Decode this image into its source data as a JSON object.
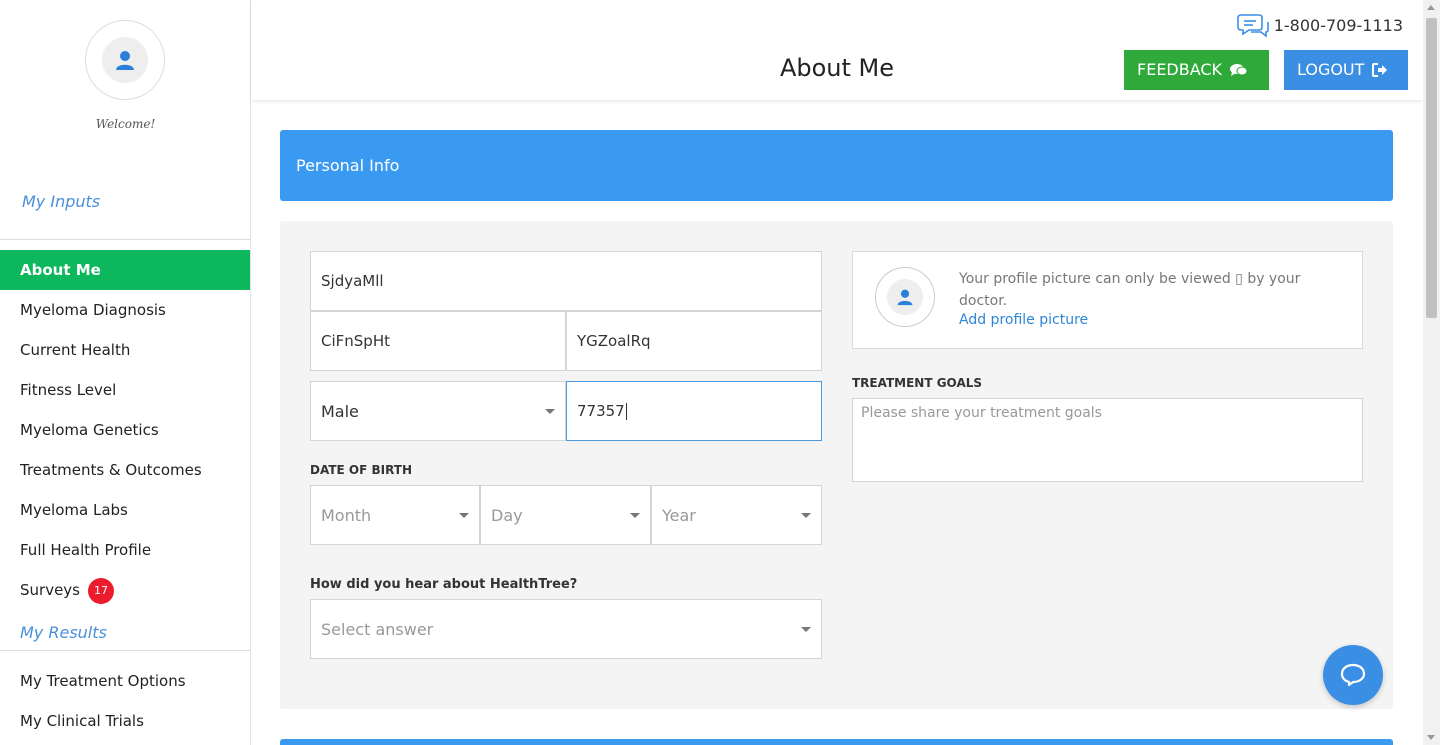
{
  "sidebar": {
    "welcome": "Welcome!",
    "inputs_title": "My Inputs",
    "results_title": "My Results",
    "items": [
      {
        "label": "About Me",
        "active": true
      },
      {
        "label": "Myeloma Diagnosis"
      },
      {
        "label": "Current Health"
      },
      {
        "label": "Fitness Level"
      },
      {
        "label": "Myeloma Genetics"
      },
      {
        "label": "Treatments & Outcomes"
      },
      {
        "label": "Myeloma Labs"
      },
      {
        "label": "Full Health Profile"
      },
      {
        "label": "Surveys",
        "badge": "17"
      }
    ],
    "result_items": [
      {
        "label": "My Treatment Options"
      },
      {
        "label": "My Clinical Trials"
      }
    ]
  },
  "header": {
    "phone": "1-800-709-1113",
    "title": "About Me",
    "feedback_label": "FEEDBACK",
    "logout_label": "LOGOUT"
  },
  "main": {
    "banner": "Personal Info",
    "form": {
      "first_name": "SjdyaMll",
      "middle_name": "CiFnSpHt",
      "last_name": "YGZoalRq",
      "gender": "Male",
      "zip": "77357",
      "dob_label": "DATE OF BIRTH",
      "dob_month": "Month",
      "dob_day": "Day",
      "dob_year": "Year",
      "hear_label": "How did you hear about HealthTree?",
      "hear_placeholder": "Select answer"
    },
    "profile": {
      "note": "Your profile picture can only be viewed ▯ by your doctor.",
      "add_link": "Add profile picture"
    },
    "goals": {
      "label": "TREATMENT GOALS",
      "placeholder": "Please share your treatment goals"
    }
  },
  "colors": {
    "active_nav": "#0cb75e",
    "banner": "#3a99f0",
    "feedback": "#2faa3a",
    "logout": "#3a8fe5",
    "badge": "#ec1c2e"
  }
}
